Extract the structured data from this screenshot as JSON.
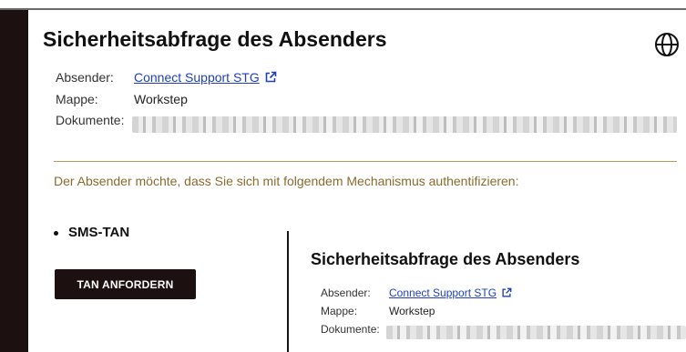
{
  "dialog": {
    "title": "Sicherheitsabfrage des Absenders",
    "sender_label": "Absender:",
    "sender_value": "Connect Support STG",
    "folder_label": "Mappe:",
    "folder_value": "Workstep",
    "documents_label": "Dokumente:",
    "instruction": "Der Absender möchte, dass Sie sich mit folgendem Mechanismus authentifizieren:",
    "method": "SMS-TAN",
    "request_button": "TAN ANFORDERN"
  },
  "overlay": {
    "title": "Sicherheitsabfrage des Absenders",
    "sender_label": "Absender:",
    "sender_value": "Connect Support STG",
    "folder_label": "Mappe:",
    "folder_value": "Workstep",
    "documents_label": "Dokumente:"
  },
  "icons": {
    "globe": "globe-icon",
    "external_link": "external-link-icon"
  },
  "colors": {
    "link": "#1f3fbf",
    "instruction_text": "#8a6a2e",
    "divider": "#b5975a",
    "dark": "#1c1010"
  }
}
